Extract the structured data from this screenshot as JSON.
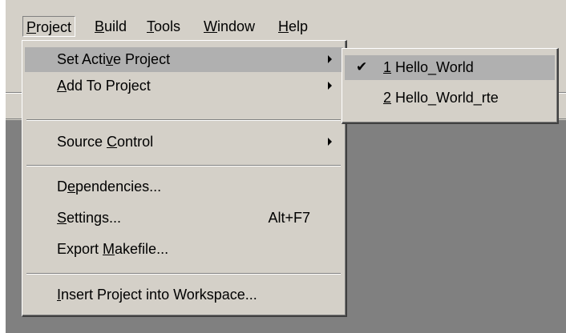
{
  "menubar": {
    "items": [
      {
        "pre": "",
        "key": "P",
        "post": "roject"
      },
      {
        "pre": "",
        "key": "B",
        "post": "uild"
      },
      {
        "pre": "",
        "key": "T",
        "post": "ools"
      },
      {
        "pre": "",
        "key": "W",
        "post": "indow"
      },
      {
        "pre": "",
        "key": "H",
        "post": "elp"
      }
    ]
  },
  "project_menu": {
    "items": [
      {
        "pre": "Set Acti",
        "key": "v",
        "post": "e Project",
        "accel": "",
        "submenu": true
      },
      {
        "pre": "",
        "key": "A",
        "post": "dd To Project",
        "accel": "",
        "submenu": true
      },
      {
        "pre": "Source ",
        "key": "C",
        "post": "ontrol",
        "accel": "",
        "submenu": true
      },
      {
        "pre": "D",
        "key": "e",
        "post": "pendencies...",
        "accel": "",
        "submenu": false
      },
      {
        "pre": "",
        "key": "S",
        "post": "ettings...",
        "accel": "Alt+F7",
        "submenu": false
      },
      {
        "pre": "Export ",
        "key": "M",
        "post": "akefile...",
        "accel": "",
        "submenu": false
      },
      {
        "pre": "",
        "key": "I",
        "post": "nsert Project into Workspace...",
        "accel": "",
        "submenu": false
      }
    ]
  },
  "active_project_submenu": {
    "items": [
      {
        "key": "1",
        "post": " Hello_World",
        "checked": true
      },
      {
        "key": "2",
        "post": " Hello_World_rte",
        "checked": false
      }
    ],
    "check_glyph": "✔"
  },
  "colors": {
    "menu_face": "#d4d0c8",
    "highlight": "#b0b0b0",
    "workspace": "#808080"
  }
}
